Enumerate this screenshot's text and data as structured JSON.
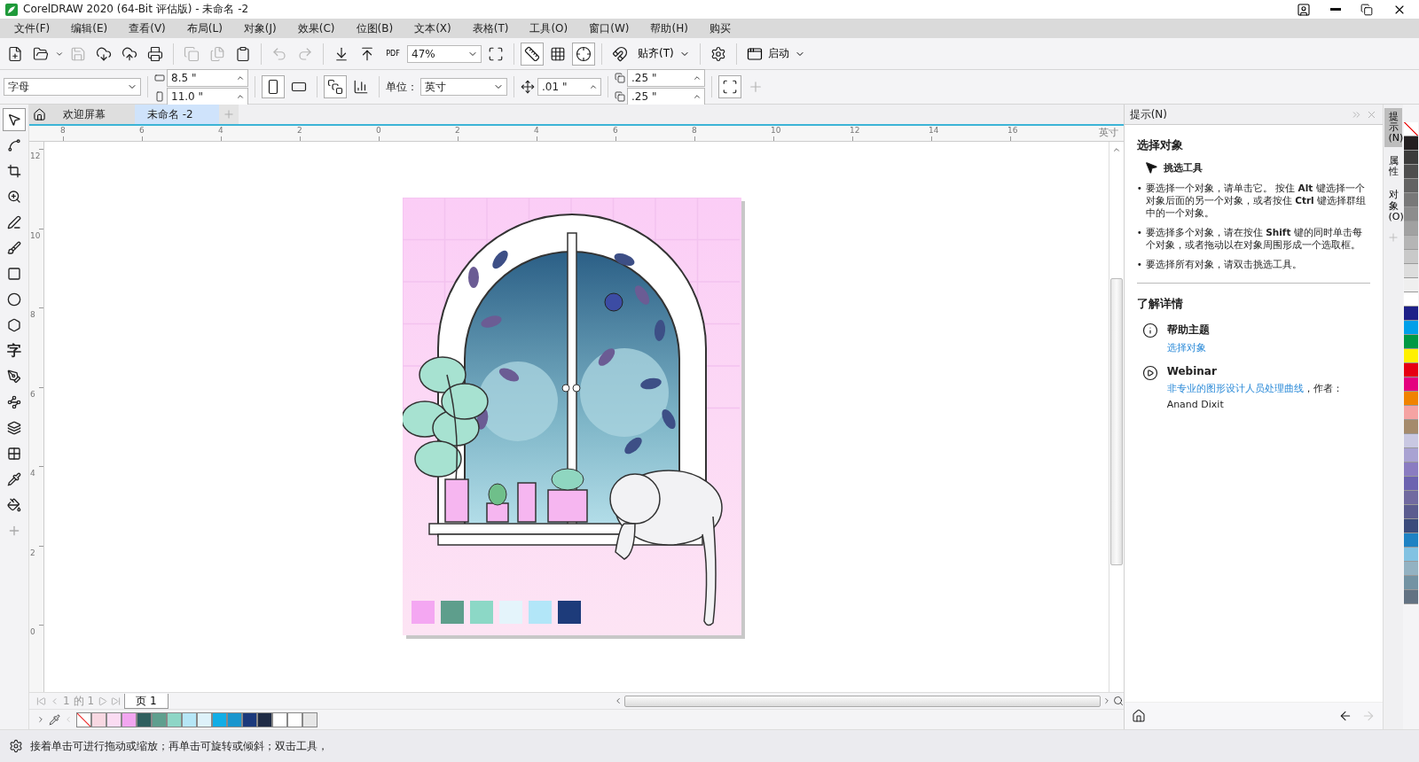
{
  "window": {
    "title": "CorelDRAW 2020 (64-Bit 评估版) - 未命名 -2"
  },
  "menu": [
    "文件(F)",
    "编辑(E)",
    "查看(V)",
    "布局(L)",
    "对象(J)",
    "效果(C)",
    "位图(B)",
    "文本(X)",
    "表格(T)",
    "工具(O)",
    "窗口(W)",
    "帮助(H)",
    "购买"
  ],
  "toolbar": {
    "pdf_label": "PDF",
    "zoom": "47%",
    "snap": "贴齐(T)",
    "launch": "启动"
  },
  "property_bar": {
    "page_size": "字母",
    "width": "8.5 \"",
    "height": "11.0 \"",
    "units_label": "单位：",
    "units": "英寸",
    "nudge": ".01 \"",
    "dup_x": ".25 \"",
    "dup_y": ".25 \""
  },
  "toolbox": {
    "text_tool_glyph": "字"
  },
  "doc_tabs": [
    {
      "label": "欢迎屏幕",
      "selected": false
    },
    {
      "label": "未命名 -2",
      "selected": true
    }
  ],
  "ruler": {
    "labels": [
      "8",
      "6",
      "4",
      "2",
      "0",
      "2",
      "4",
      "6",
      "8",
      "10",
      "12",
      "14",
      "16"
    ],
    "unit": "英寸",
    "vertical_labels": [
      "12",
      "10",
      "8",
      "6",
      "4",
      "2",
      "0"
    ]
  },
  "page_nav": {
    "current": "1",
    "of": "的",
    "total": "1",
    "page_tab": "页 1"
  },
  "doc_palette": [
    {
      "kind": "none"
    },
    {
      "kind": "color",
      "color": "#f8d8e2"
    },
    {
      "kind": "color",
      "color": "#fbdcf2"
    },
    {
      "kind": "color",
      "color": "#f2a6f0"
    },
    {
      "kind": "color",
      "color": "#2f5f5e"
    },
    {
      "kind": "color",
      "color": "#5f9f8e"
    },
    {
      "kind": "color",
      "color": "#8ed6c6"
    },
    {
      "kind": "color",
      "color": "#b6e6f6"
    },
    {
      "kind": "color",
      "color": "#def2fa"
    },
    {
      "kind": "color",
      "color": "#12aee6"
    },
    {
      "kind": "color",
      "color": "#1a96ce"
    },
    {
      "kind": "color",
      "color": "#1c3a7c"
    },
    {
      "kind": "color",
      "color": "#1f2b45"
    },
    {
      "kind": "color",
      "color": "#ffffff"
    },
    {
      "kind": "color",
      "color": "#fefefe"
    },
    {
      "kind": "color",
      "color": "#e6e6e6"
    }
  ],
  "docker": {
    "title": "提示(N)",
    "heading": "选择对象",
    "tool": "挑选工具",
    "bullet_mark": "•",
    "bullets": [
      "要选择一个对象，请单击它。 按住 **Alt** 键选择一个对象后面的另一个对象，或者按住 **Ctrl** 键选择群组中的一个对象。",
      "要选择多个对象，请在按住 **Shift** 键的同时单击每个对象，或者拖动以在对象周围形成一个选取框。",
      "要选择所有对象，请双击挑选工具。"
    ],
    "more_heading": "了解详情",
    "help": {
      "title": "帮助主题",
      "link": "选择对象"
    },
    "webinar": {
      "title": "Webinar",
      "link": "非专业的图形设计人员处理曲线",
      "byline": "，作者：",
      "author": "Anand Dixit"
    }
  },
  "docker_tabs": [
    {
      "label": "提示(N)",
      "selected": true
    },
    {
      "label": "属性",
      "selected": false
    },
    {
      "label": "对象 (O)",
      "selected": false
    }
  ],
  "palette": [
    {
      "kind": "none"
    },
    {
      "kind": "color",
      "color": "#231f20"
    },
    {
      "kind": "color",
      "color": "#3b3b3b"
    },
    {
      "kind": "color",
      "color": "#4e4e4e"
    },
    {
      "kind": "color",
      "color": "#636363"
    },
    {
      "kind": "color",
      "color": "#787878"
    },
    {
      "kind": "color",
      "color": "#8d8d8d"
    },
    {
      "kind": "color",
      "color": "#a1a1a1"
    },
    {
      "kind": "color",
      "color": "#b5b5b5"
    },
    {
      "kind": "color",
      "color": "#c9c9c9"
    },
    {
      "kind": "color",
      "color": "#dddddd"
    },
    {
      "kind": "color",
      "color": "#efefef"
    },
    {
      "kind": "color",
      "color": "#ffffff"
    },
    {
      "kind": "color",
      "color": "#1d2088"
    },
    {
      "kind": "color",
      "color": "#00a0e9"
    },
    {
      "kind": "color",
      "color": "#009944"
    },
    {
      "kind": "color",
      "color": "#fff100"
    },
    {
      "kind": "color",
      "color": "#e60012"
    },
    {
      "kind": "color",
      "color": "#e4007f"
    },
    {
      "kind": "color",
      "color": "#f08300"
    },
    {
      "kind": "color",
      "color": "#f5a3a3"
    },
    {
      "kind": "color",
      "color": "#a58b6c"
    },
    {
      "kind": "color",
      "color": "#c9c8e2"
    },
    {
      "kind": "color",
      "color": "#a9a2d2"
    },
    {
      "kind": "color",
      "color": "#8a7cc1"
    },
    {
      "kind": "color",
      "color": "#6c63b0"
    },
    {
      "kind": "color",
      "color": "#716aa0"
    },
    {
      "kind": "color",
      "color": "#5b5c8f"
    },
    {
      "kind": "color",
      "color": "#3b4b7b"
    },
    {
      "kind": "color",
      "color": "#1e82c3"
    },
    {
      "kind": "color",
      "color": "#82c2e2"
    },
    {
      "kind": "color",
      "color": "#93b2c2"
    },
    {
      "kind": "color",
      "color": "#7393a3"
    },
    {
      "kind": "color",
      "color": "#627282"
    }
  ],
  "status_bar": {
    "text": "接着单击可进行拖动或缩放；再单击可旋转或倾斜；双击工具，"
  }
}
